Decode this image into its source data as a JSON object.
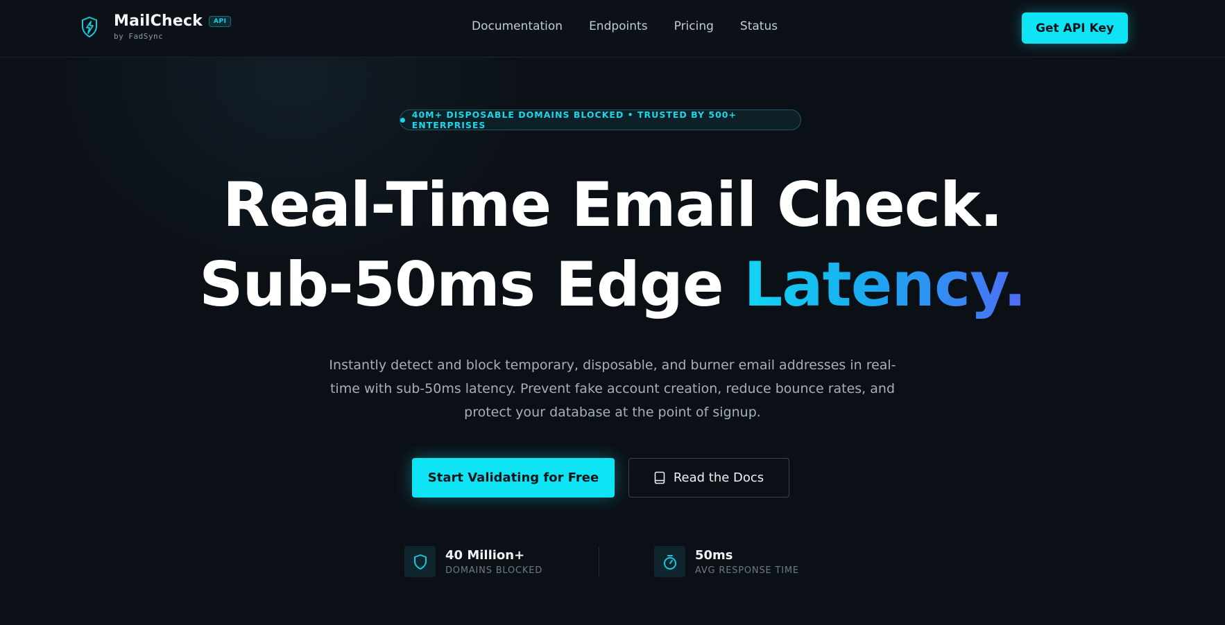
{
  "brand": {
    "name": "MailCheck",
    "badge": "API",
    "subtitle": "by FadSync",
    "icon": "lightning-shield-icon",
    "accent_color": "#0ee4f4"
  },
  "nav": {
    "items": [
      {
        "label": "Documentation"
      },
      {
        "label": "Endpoints"
      },
      {
        "label": "Pricing"
      },
      {
        "label": "Status"
      }
    ],
    "cta_label": "Get API Key"
  },
  "hero": {
    "pill_text": "40M+ DISPOSABLE DOMAINS BLOCKED • TRUSTED BY 500+ ENTERPRISES",
    "title_line1": "Real-Time Email Check.",
    "title_line2_plain": "Sub-50ms Edge ",
    "title_line2_highlight": "Latency.",
    "description": "Instantly detect and block temporary, disposable, and burner email addresses in real-time with sub-50ms latency. Prevent fake account creation, reduce bounce rates, and protect your database at the point of signup.",
    "primary_button": "Start Validating for Free",
    "secondary_button": "Read the Docs",
    "secondary_icon": "book-icon"
  },
  "stats": [
    {
      "value": "40 Million+",
      "label": "DOMAINS BLOCKED",
      "icon": "shield-icon"
    },
    {
      "value": "50ms",
      "label": "AVG RESPONSE TIME",
      "icon": "stopwatch-icon"
    }
  ]
}
